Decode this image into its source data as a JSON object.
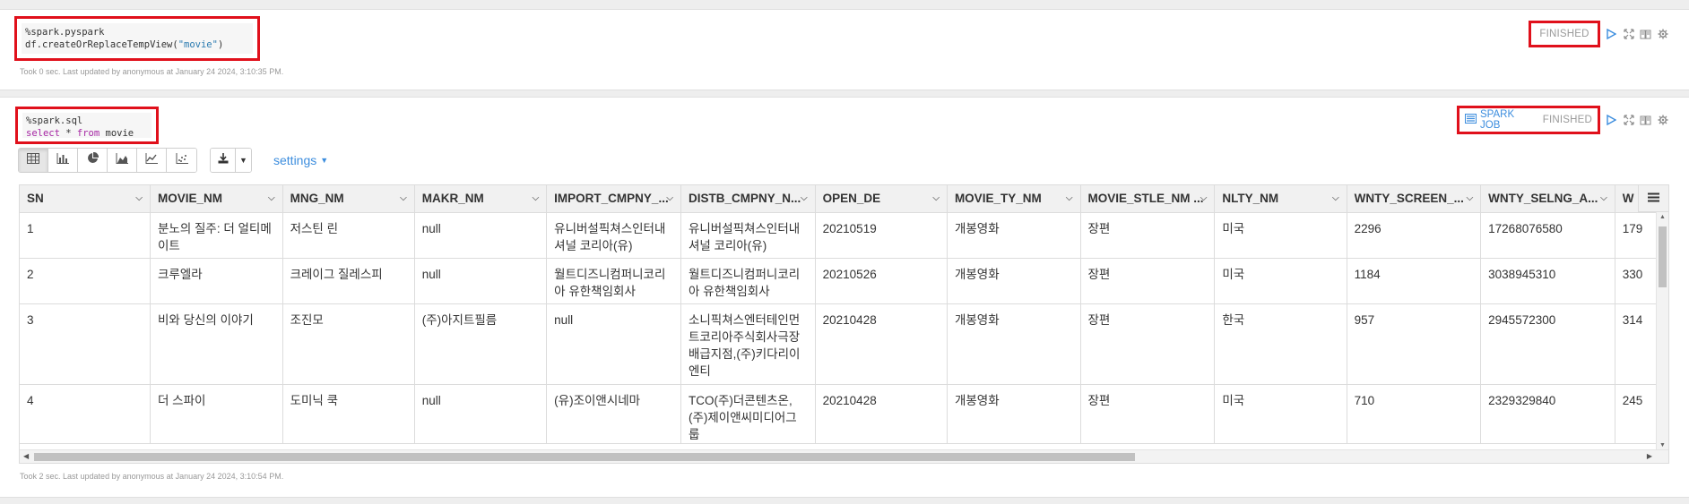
{
  "paragraph1": {
    "code_lines": [
      "%spark.pyspark",
      "df.createOrReplaceTempView(\"movie\")"
    ],
    "code_parts": {
      "line2_prefix": "df.createOrReplaceTempView(",
      "line2_string": "\"movie\"",
      "line2_suffix": ")"
    },
    "status": "FINISHED",
    "footer": "Took 0 sec. Last updated by anonymous at January 24 2024, 3:10:35 PM."
  },
  "paragraph2": {
    "code_line1": "%spark.sql",
    "code_kw1": "select",
    "code_mid": " * ",
    "code_kw2": "from",
    "code_end": " movie",
    "spark_job_label": "SPARK JOB",
    "status": "FINISHED",
    "settings_label": "settings",
    "footer": "Took 2 sec. Last updated by anonymous at January 24 2024, 3:10:54 PM.",
    "viz_buttons": [
      "table-icon",
      "bar-chart-icon",
      "pie-chart-icon",
      "area-chart-icon",
      "line-chart-icon",
      "scatter-chart-icon"
    ],
    "table": {
      "columns": [
        "SN",
        "MOVIE_NM",
        "MNG_NM",
        "MAKR_NM",
        "IMPORT_CMPNY_...",
        "DISTB_CMPNY_N...",
        "OPEN_DE",
        "MOVIE_TY_NM",
        "MOVIE_STLE_NM ...",
        "NLTY_NM",
        "WNTY_SCREEN_...",
        "WNTY_SELNG_A...",
        "W"
      ],
      "rows": [
        [
          "1",
          "분노의 질주: 더 얼티메이트",
          "저스틴 린",
          "null",
          "유니버설픽쳐스인터내셔널 코리아(유)",
          "유니버설픽쳐스인터내셔널 코리아(유)",
          "20210519",
          "개봉영화",
          "장편",
          "미국",
          "2296",
          "17268076580",
          "179"
        ],
        [
          "2",
          "크루엘라",
          "크레이그 질레스피",
          "null",
          "월트디즈니컴퍼니코리아 유한책임회사",
          "월트디즈니컴퍼니코리아 유한책임회사",
          "20210526",
          "개봉영화",
          "장편",
          "미국",
          "1184",
          "3038945310",
          "330"
        ],
        [
          "3",
          "비와 당신의 이야기",
          "조진모",
          "(주)아지트필름",
          "null",
          "소니픽쳐스엔터테인먼트코리아주식회사극장배급지점,(주)키다리이엔티",
          "20210428",
          "개봉영화",
          "장편",
          "한국",
          "957",
          "2945572300",
          "314"
        ],
        [
          "4",
          "더 스파이",
          "도미닉 쿡",
          "null",
          "(유)조이앤시네마",
          "TCO(주)더콘텐츠온,(주)제이앤씨미디어그룹",
          "20210428",
          "개봉영화",
          "장편",
          "미국",
          "710",
          "2329329840",
          "245"
        ]
      ]
    }
  }
}
